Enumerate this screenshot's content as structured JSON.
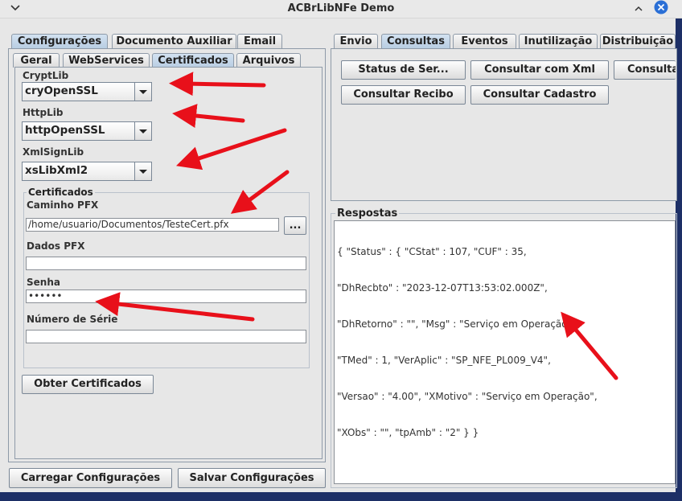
{
  "window": {
    "title": "ACBrLibNFe Demo"
  },
  "left_tabs": [
    "Configurações",
    "Documento Auxiliar",
    "Email"
  ],
  "left_subtabs": [
    "Geral",
    "WebServices",
    "Certificados",
    "Arquivos"
  ],
  "certificados": {
    "cryptlib_label": "CryptLib",
    "cryptlib_value": "cryOpenSSL",
    "httplib_label": "HttpLib",
    "httplib_value": "httpOpenSSL",
    "xmlsignlib_label": "XmlSignLib",
    "xmlsignlib_value": "xsLibXml2",
    "group_title": "Certificados",
    "caminho_label": "Caminho PFX",
    "caminho_value": "/home/usuario/Documentos/TesteCert.pfx",
    "browse_label": "...",
    "dados_label": "Dados PFX",
    "dados_value": "",
    "senha_label": "Senha",
    "senha_value": "••••••",
    "numero_label": "Número de Série",
    "numero_value": "",
    "obter_button": "Obter Certificados"
  },
  "bottom_buttons": {
    "carregar": "Carregar Configurações",
    "salvar": "Salvar Configurações"
  },
  "right_tabs": [
    "Envio",
    "Consultas",
    "Eventos",
    "Inutilização",
    "Distribuição"
  ],
  "consultas": {
    "status_button": "Status de Ser...",
    "consultar_xml_button": "Consultar com Xml",
    "consulta_button": "Consulta",
    "recibo_button": "Consultar Recibo",
    "cadastro_button": "Consultar Cadastro"
  },
  "respostas": {
    "title": "Respostas",
    "lines": [
      "{ \"Status\" : { \"CStat\" : 107, \"CUF\" : 35,",
      "\"DhRecbto\" : \"2023-12-07T13:53:02.000Z\",",
      "\"DhRetorno\" : \"\", \"Msg\" : \"Serviço em Operação\",",
      "\"TMed\" : 1, \"VerAplic\" : \"SP_NFE_PL009_V4\",",
      "\"Versao\" : \"4.00\", \"XMotivo\" : \"Serviço em Operação\",",
      "\"XObs\" : \"\", \"tpAmb\" : \"2\" } }"
    ]
  },
  "colors": {
    "annotation_arrow": "#e8101a",
    "selected_tab": "#c4d6ea",
    "close_button": "#2a6fd6"
  },
  "icons": {
    "menu": "chevron-down-icon",
    "close": "close-icon"
  }
}
